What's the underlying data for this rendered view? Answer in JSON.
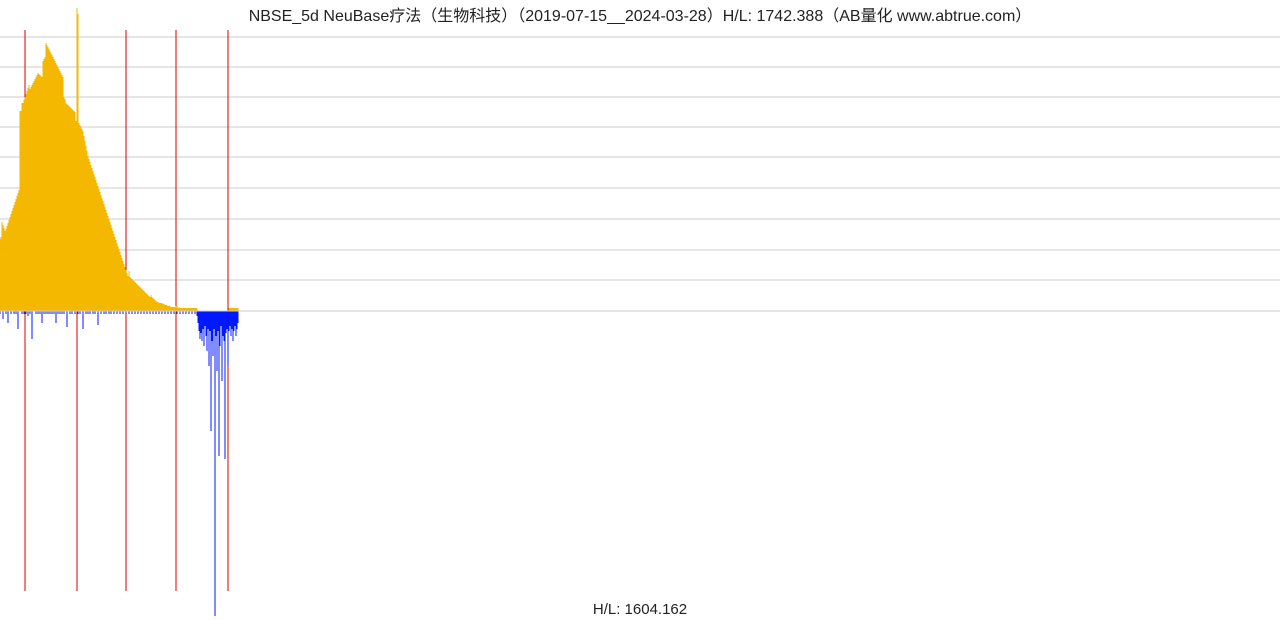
{
  "title": "NBSE_5d NeuBase疗法（生物科技）（2019-07-15__2024-03-28）H/L: 1742.388（AB量化  www.abtrue.com）",
  "footer_hl": "H/L: 1604.162",
  "chart_data": {
    "type": "bar",
    "title": "NBSE_5d NeuBase疗法（生物科技）",
    "date_range": [
      "2019-07-15",
      "2024-03-28"
    ],
    "hl_top": 1742.388,
    "hl_bottom": 1604.162,
    "x_range": [
      0,
      1279
    ],
    "baseline_y": 311,
    "gridlines_y": [
      37,
      67,
      97,
      127,
      157,
      188,
      219,
      250,
      280,
      311
    ],
    "red_vlines_x": [
      25,
      77,
      126,
      176,
      228
    ],
    "colors": {
      "pos": "#f5b800",
      "neg": "#0018ff",
      "grid": "#cccccc",
      "vline": "#d80000"
    },
    "series_pos": [
      [
        0,
        72
      ],
      [
        1,
        74
      ],
      [
        2,
        89
      ],
      [
        3,
        86
      ],
      [
        4,
        83
      ],
      [
        5,
        80
      ],
      [
        6,
        82
      ],
      [
        7,
        85
      ],
      [
        8,
        88
      ],
      [
        9,
        91
      ],
      [
        10,
        94
      ],
      [
        11,
        97
      ],
      [
        12,
        100
      ],
      [
        13,
        103
      ],
      [
        14,
        106
      ],
      [
        15,
        109
      ],
      [
        16,
        112
      ],
      [
        17,
        115
      ],
      [
        18,
        118
      ],
      [
        19,
        121
      ],
      [
        20,
        200
      ],
      [
        21,
        200
      ],
      [
        22,
        208
      ],
      [
        23,
        208
      ],
      [
        24,
        211
      ],
      [
        25,
        214
      ],
      [
        26,
        217
      ],
      [
        27,
        220
      ],
      [
        28,
        223
      ],
      [
        29,
        226
      ],
      [
        30,
        222
      ],
      [
        31,
        224
      ],
      [
        32,
        226
      ],
      [
        33,
        228
      ],
      [
        34,
        230
      ],
      [
        35,
        232
      ],
      [
        36,
        234
      ],
      [
        37,
        236
      ],
      [
        38,
        238
      ],
      [
        39,
        237
      ],
      [
        40,
        236
      ],
      [
        41,
        235
      ],
      [
        42,
        234
      ],
      [
        43,
        250
      ],
      [
        44,
        252
      ],
      [
        45,
        254
      ],
      [
        46,
        268
      ],
      [
        47,
        266
      ],
      [
        48,
        264
      ],
      [
        49,
        262
      ],
      [
        50,
        260
      ],
      [
        51,
        258
      ],
      [
        52,
        256
      ],
      [
        53,
        254
      ],
      [
        54,
        252
      ],
      [
        55,
        250
      ],
      [
        56,
        248
      ],
      [
        57,
        246
      ],
      [
        58,
        244
      ],
      [
        59,
        242
      ],
      [
        60,
        240
      ],
      [
        61,
        238
      ],
      [
        62,
        236
      ],
      [
        63,
        234
      ],
      [
        64,
        214
      ],
      [
        65,
        212
      ],
      [
        66,
        208
      ],
      [
        67,
        207
      ],
      [
        68,
        206
      ],
      [
        69,
        205
      ],
      [
        70,
        204
      ],
      [
        71,
        203
      ],
      [
        72,
        202
      ],
      [
        73,
        201
      ],
      [
        74,
        200
      ],
      [
        75,
        199
      ],
      [
        76,
        190
      ],
      [
        77,
        303
      ],
      [
        78,
        297
      ],
      [
        79,
        188
      ],
      [
        80,
        186
      ],
      [
        81,
        184
      ],
      [
        82,
        182
      ],
      [
        83,
        180
      ],
      [
        84,
        175
      ],
      [
        85,
        170
      ],
      [
        86,
        165
      ],
      [
        87,
        160
      ],
      [
        88,
        155
      ],
      [
        89,
        152
      ],
      [
        90,
        149
      ],
      [
        91,
        146
      ],
      [
        92,
        143
      ],
      [
        93,
        140
      ],
      [
        94,
        137
      ],
      [
        95,
        134
      ],
      [
        96,
        131
      ],
      [
        97,
        128
      ],
      [
        98,
        125
      ],
      [
        99,
        122
      ],
      [
        100,
        119
      ],
      [
        101,
        116
      ],
      [
        102,
        113
      ],
      [
        103,
        110
      ],
      [
        104,
        107
      ],
      [
        105,
        104
      ],
      [
        106,
        101
      ],
      [
        107,
        98
      ],
      [
        108,
        95
      ],
      [
        109,
        92
      ],
      [
        110,
        89
      ],
      [
        111,
        86
      ],
      [
        112,
        83
      ],
      [
        113,
        80
      ],
      [
        114,
        77
      ],
      [
        115,
        74
      ],
      [
        116,
        71
      ],
      [
        117,
        68
      ],
      [
        118,
        65
      ],
      [
        119,
        62
      ],
      [
        120,
        59
      ],
      [
        121,
        56
      ],
      [
        122,
        53
      ],
      [
        123,
        50
      ],
      [
        124,
        47
      ],
      [
        125,
        44
      ],
      [
        126,
        41
      ],
      [
        127,
        38
      ],
      [
        128,
        35
      ],
      [
        129,
        40
      ],
      [
        130,
        34
      ],
      [
        131,
        33
      ],
      [
        132,
        32
      ],
      [
        133,
        31
      ],
      [
        134,
        30
      ],
      [
        135,
        29
      ],
      [
        136,
        28
      ],
      [
        137,
        27
      ],
      [
        138,
        26
      ],
      [
        139,
        25
      ],
      [
        140,
        24
      ],
      [
        141,
        23
      ],
      [
        142,
        22
      ],
      [
        143,
        21
      ],
      [
        144,
        20
      ],
      [
        145,
        19
      ],
      [
        146,
        18
      ],
      [
        147,
        17
      ],
      [
        148,
        16
      ],
      [
        149,
        15
      ],
      [
        150,
        14
      ],
      [
        151,
        16
      ],
      [
        152,
        14
      ],
      [
        153,
        13
      ],
      [
        154,
        12
      ],
      [
        155,
        11
      ],
      [
        156,
        10
      ],
      [
        157,
        9
      ],
      [
        158,
        9
      ],
      [
        159,
        8
      ],
      [
        160,
        8
      ],
      [
        161,
        8
      ],
      [
        162,
        8
      ],
      [
        163,
        7
      ],
      [
        164,
        7
      ],
      [
        165,
        6
      ],
      [
        166,
        6
      ],
      [
        167,
        6
      ],
      [
        168,
        5
      ],
      [
        169,
        5
      ],
      [
        170,
        5
      ],
      [
        171,
        4
      ],
      [
        172,
        4
      ],
      [
        173,
        4
      ],
      [
        174,
        4
      ],
      [
        175,
        4
      ],
      [
        176,
        5
      ],
      [
        177,
        5
      ],
      [
        178,
        3
      ],
      [
        179,
        4
      ],
      [
        180,
        3
      ],
      [
        181,
        3
      ],
      [
        182,
        3
      ],
      [
        183,
        3
      ],
      [
        184,
        3
      ],
      [
        185,
        3
      ],
      [
        186,
        3
      ],
      [
        187,
        3
      ],
      [
        188,
        3
      ],
      [
        189,
        3
      ],
      [
        190,
        3
      ],
      [
        191,
        3
      ],
      [
        192,
        3
      ],
      [
        193,
        3
      ],
      [
        194,
        3
      ],
      [
        195,
        3
      ],
      [
        196,
        3
      ],
      [
        197,
        3
      ],
      [
        198,
        0
      ],
      [
        199,
        0
      ],
      [
        200,
        0
      ],
      [
        201,
        0
      ],
      [
        202,
        0
      ],
      [
        203,
        0
      ],
      [
        204,
        0
      ],
      [
        205,
        0
      ],
      [
        206,
        0
      ],
      [
        207,
        0
      ],
      [
        208,
        0
      ],
      [
        209,
        0
      ],
      [
        210,
        0
      ],
      [
        211,
        0
      ],
      [
        212,
        0
      ],
      [
        213,
        0
      ],
      [
        214,
        0
      ],
      [
        215,
        0
      ],
      [
        216,
        0
      ],
      [
        217,
        0
      ],
      [
        218,
        0
      ],
      [
        219,
        0
      ],
      [
        220,
        0
      ],
      [
        221,
        0
      ],
      [
        222,
        0
      ],
      [
        223,
        0
      ],
      [
        224,
        0
      ],
      [
        225,
        0
      ],
      [
        226,
        0
      ],
      [
        227,
        0
      ],
      [
        228,
        0
      ],
      [
        229,
        3
      ],
      [
        230,
        3
      ],
      [
        231,
        3
      ],
      [
        232,
        3
      ],
      [
        233,
        3
      ],
      [
        234,
        3
      ],
      [
        235,
        3
      ],
      [
        236,
        3
      ],
      [
        237,
        3
      ],
      [
        238,
        3
      ]
    ],
    "series_neg": [
      [
        0,
        3
      ],
      [
        3,
        8
      ],
      [
        6,
        3
      ],
      [
        8,
        12
      ],
      [
        11,
        3
      ],
      [
        14,
        3
      ],
      [
        16,
        3
      ],
      [
        18,
        18
      ],
      [
        22,
        3
      ],
      [
        24,
        3
      ],
      [
        26,
        3
      ],
      [
        28,
        5
      ],
      [
        30,
        3
      ],
      [
        32,
        28
      ],
      [
        36,
        3
      ],
      [
        38,
        3
      ],
      [
        40,
        3
      ],
      [
        42,
        12
      ],
      [
        44,
        3
      ],
      [
        46,
        3
      ],
      [
        48,
        3
      ],
      [
        50,
        3
      ],
      [
        52,
        3
      ],
      [
        54,
        3
      ],
      [
        56,
        12
      ],
      [
        58,
        3
      ],
      [
        60,
        3
      ],
      [
        62,
        3
      ],
      [
        64,
        3
      ],
      [
        67,
        16
      ],
      [
        70,
        3
      ],
      [
        72,
        3
      ],
      [
        75,
        3
      ],
      [
        78,
        3
      ],
      [
        80,
        3
      ],
      [
        83,
        18
      ],
      [
        86,
        3
      ],
      [
        88,
        3
      ],
      [
        90,
        3
      ],
      [
        93,
        3
      ],
      [
        95,
        3
      ],
      [
        98,
        14
      ],
      [
        101,
        3
      ],
      [
        104,
        3
      ],
      [
        106,
        3
      ],
      [
        109,
        3
      ],
      [
        111,
        3
      ],
      [
        114,
        3
      ],
      [
        117,
        3
      ],
      [
        120,
        3
      ],
      [
        123,
        3
      ],
      [
        126,
        3
      ],
      [
        129,
        3
      ],
      [
        132,
        3
      ],
      [
        135,
        3
      ],
      [
        138,
        3
      ],
      [
        141,
        3
      ],
      [
        144,
        3
      ],
      [
        147,
        3
      ],
      [
        150,
        3
      ],
      [
        153,
        3
      ],
      [
        156,
        3
      ],
      [
        159,
        3
      ],
      [
        162,
        3
      ],
      [
        165,
        3
      ],
      [
        168,
        3
      ],
      [
        171,
        3
      ],
      [
        174,
        3
      ],
      [
        177,
        3
      ],
      [
        180,
        3
      ],
      [
        183,
        3
      ],
      [
        186,
        3
      ],
      [
        189,
        3
      ],
      [
        192,
        3
      ],
      [
        195,
        3
      ],
      [
        197,
        5
      ],
      [
        198,
        12
      ],
      [
        199,
        20
      ],
      [
        200,
        28
      ],
      [
        201,
        22
      ],
      [
        202,
        30
      ],
      [
        203,
        18
      ],
      [
        204,
        35
      ],
      [
        205,
        15
      ],
      [
        206,
        25
      ],
      [
        207,
        40
      ],
      [
        208,
        18
      ],
      [
        209,
        55
      ],
      [
        210,
        20
      ],
      [
        211,
        120
      ],
      [
        212,
        30
      ],
      [
        213,
        45
      ],
      [
        214,
        18
      ],
      [
        215,
        305
      ],
      [
        216,
        25
      ],
      [
        217,
        60
      ],
      [
        218,
        20
      ],
      [
        219,
        145
      ],
      [
        220,
        35
      ],
      [
        221,
        15
      ],
      [
        222,
        70
      ],
      [
        223,
        25
      ],
      [
        224,
        30
      ],
      [
        225,
        148
      ],
      [
        226,
        22
      ],
      [
        227,
        18
      ],
      [
        228,
        55
      ],
      [
        229,
        20
      ],
      [
        230,
        15
      ],
      [
        231,
        25
      ],
      [
        232,
        18
      ],
      [
        233,
        30
      ],
      [
        234,
        20
      ],
      [
        235,
        15
      ],
      [
        236,
        25
      ],
      [
        237,
        18
      ],
      [
        238,
        12
      ]
    ]
  }
}
